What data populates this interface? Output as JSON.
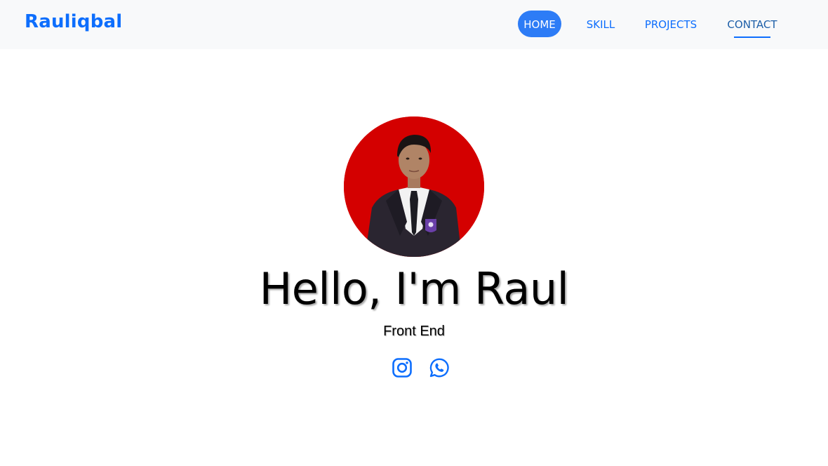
{
  "navbar": {
    "brand": "Rauliqbal",
    "items": [
      {
        "label": "HOME",
        "state": "active"
      },
      {
        "label": "SKILL",
        "state": "default"
      },
      {
        "label": "PROJECTS",
        "state": "default"
      },
      {
        "label": "CONTACT",
        "state": "hovered"
      }
    ]
  },
  "hero": {
    "title": "Hello, I'm Raul",
    "subtitle": "Front End",
    "avatar_background": "#d40000",
    "social_links": [
      {
        "icon": "instagram-icon"
      },
      {
        "icon": "whatsapp-icon"
      }
    ]
  },
  "colors": {
    "accent": "#0d6efd",
    "active_pill": "#2d7cf6",
    "navbar_bg": "#f8f9fa"
  }
}
